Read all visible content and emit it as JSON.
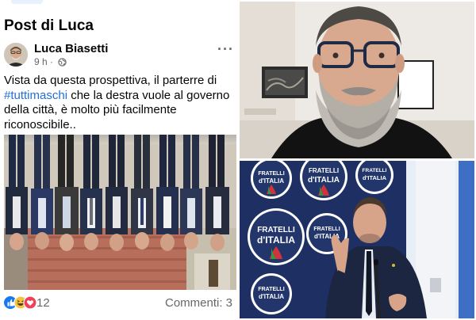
{
  "post": {
    "section_title": "Post di Luca",
    "author": "Luca Biasetti",
    "time": "9 h",
    "more_label": "···",
    "text_lines": [
      {
        "before": "Vista da questa prospettiva, il parterre di",
        "tag": "",
        "after": ""
      },
      {
        "before": "",
        "tag": "#tuttimaschi",
        "after": " che la destra vuole al governo"
      },
      {
        "before": "della città, è molto più facilmente",
        "tag": "",
        "after": ""
      },
      {
        "before": "riconoscibile..",
        "tag": "",
        "after": ""
      }
    ],
    "reaction_icons": [
      "like-icon",
      "haha-icon",
      "love-icon"
    ],
    "reaction_count": "12",
    "comments_label": "Commenti: 3"
  },
  "speaker_photo": {
    "logo_line1": "FRATELLI",
    "logo_line2": "d'ITALIA"
  },
  "colors": {
    "facebook_blue": "#1877f2",
    "hashtag": "#216fdb",
    "meta_gray": "#65676b",
    "fdi_navy": "#23366b",
    "fdi_backdrop": "#1d2f63"
  }
}
